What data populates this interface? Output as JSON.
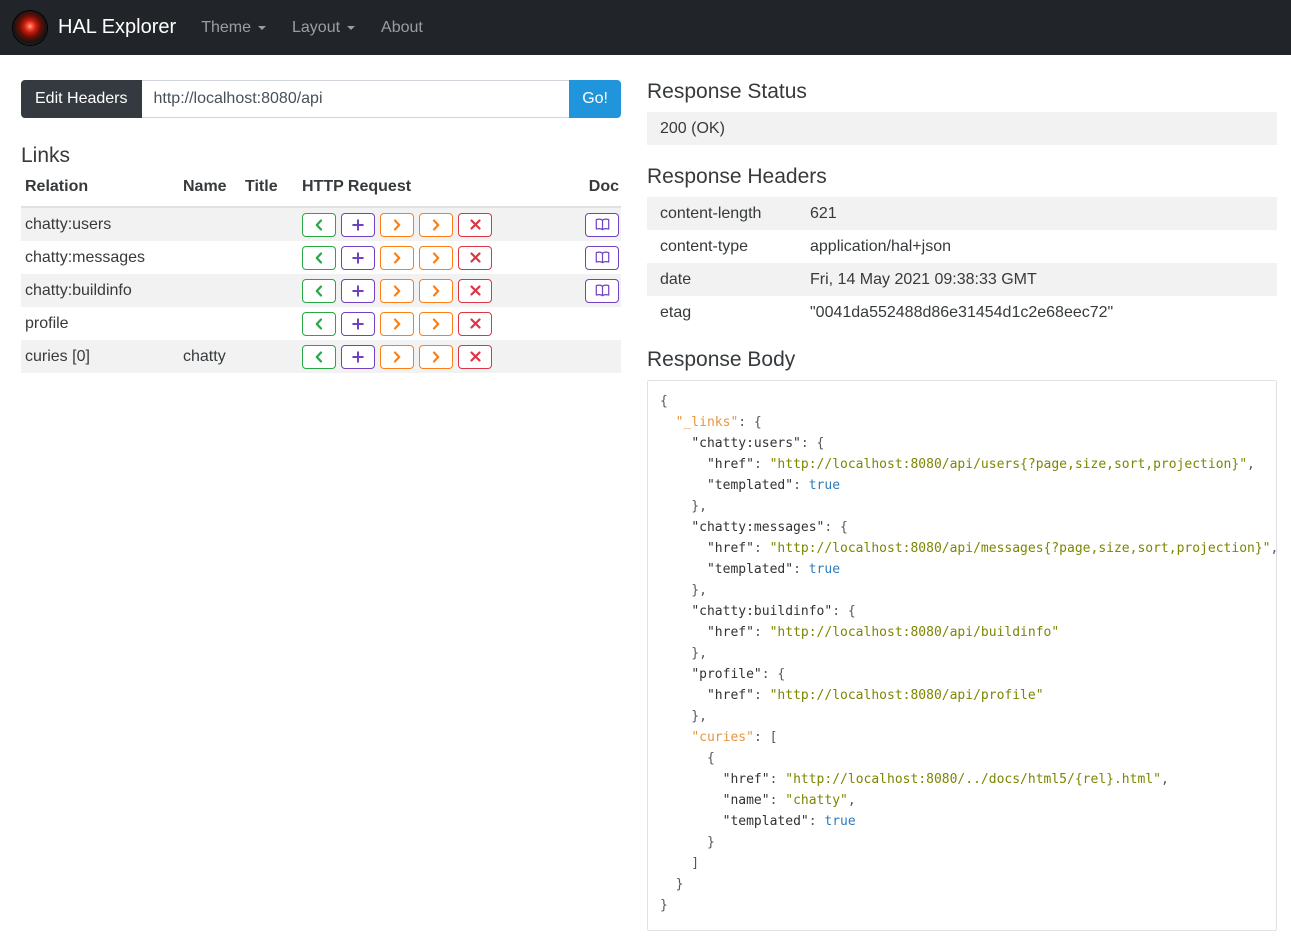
{
  "navbar": {
    "brand": "HAL Explorer",
    "logo_icon": "hal-eye-icon",
    "items": [
      {
        "label": "Theme",
        "has_caret": true
      },
      {
        "label": "Layout",
        "has_caret": true
      },
      {
        "label": "About",
        "has_caret": false
      }
    ]
  },
  "request_bar": {
    "edit_headers_label": "Edit Headers",
    "url_value": "http://localhost:8080/api",
    "go_label": "Go!"
  },
  "links_section": {
    "title": "Links",
    "columns": [
      "Relation",
      "Name",
      "Title",
      "HTTP Request",
      "Doc"
    ],
    "rows": [
      {
        "relation": "chatty:users",
        "name": "",
        "title": "",
        "doc": true
      },
      {
        "relation": "chatty:messages",
        "name": "",
        "title": "",
        "doc": true
      },
      {
        "relation": "chatty:buildinfo",
        "name": "",
        "title": "",
        "doc": true
      },
      {
        "relation": "profile",
        "name": "",
        "title": "",
        "doc": false
      },
      {
        "relation": "curies [0]",
        "name": "chatty",
        "title": "",
        "doc": false
      }
    ],
    "http_buttons": [
      {
        "name": "get-request-button",
        "icon": "chevron-left-icon",
        "color": "#28a745"
      },
      {
        "name": "post-request-button",
        "icon": "plus-icon",
        "color": "#6f42c1"
      },
      {
        "name": "put-request-button",
        "icon": "chevron-right-icon",
        "color": "#fd7e14"
      },
      {
        "name": "patch-request-button",
        "icon": "chevron-right-icon",
        "color": "#fd7e14"
      },
      {
        "name": "delete-request-button",
        "icon": "x-icon",
        "color": "#dc3545"
      }
    ],
    "doc_button": {
      "name": "doc-button",
      "icon": "book-icon",
      "color": "#6f42c1"
    }
  },
  "response": {
    "status_title": "Response Status",
    "status_value": "200 (OK)",
    "headers_title": "Response Headers",
    "headers": [
      {
        "name": "content-length",
        "value": "621"
      },
      {
        "name": "content-type",
        "value": "application/hal+json"
      },
      {
        "name": "date",
        "value": "Fri, 14 May 2021 09:38:33 GMT"
      },
      {
        "name": "etag",
        "value": "\"0041da552488d86e31454d1c2e68eec72\""
      }
    ],
    "body_title": "Response Body",
    "body_lines": [
      [
        [
          "pl",
          "{"
        ]
      ],
      [
        [
          "pl",
          "  "
        ],
        [
          "okey",
          "\"_links\""
        ],
        [
          "pl",
          ": {"
        ]
      ],
      [
        [
          "pl",
          "    "
        ],
        [
          "key",
          "\"chatty:users\""
        ],
        [
          "pl",
          ": {"
        ]
      ],
      [
        [
          "pl",
          "      "
        ],
        [
          "key",
          "\"href\""
        ],
        [
          "pl",
          ": "
        ],
        [
          "str",
          "\"http://localhost:8080/api/users{?page,size,sort,projection}\""
        ],
        [
          "pl",
          ","
        ]
      ],
      [
        [
          "pl",
          "      "
        ],
        [
          "key",
          "\"templated\""
        ],
        [
          "pl",
          ": "
        ],
        [
          "bool",
          "true"
        ]
      ],
      [
        [
          "pl",
          "    },"
        ]
      ],
      [
        [
          "pl",
          "    "
        ],
        [
          "key",
          "\"chatty:messages\""
        ],
        [
          "pl",
          ": {"
        ]
      ],
      [
        [
          "pl",
          "      "
        ],
        [
          "key",
          "\"href\""
        ],
        [
          "pl",
          ": "
        ],
        [
          "str",
          "\"http://localhost:8080/api/messages{?page,size,sort,projection}\""
        ],
        [
          "pl",
          ","
        ]
      ],
      [
        [
          "pl",
          "      "
        ],
        [
          "key",
          "\"templated\""
        ],
        [
          "pl",
          ": "
        ],
        [
          "bool",
          "true"
        ]
      ],
      [
        [
          "pl",
          "    },"
        ]
      ],
      [
        [
          "pl",
          "    "
        ],
        [
          "key",
          "\"chatty:buildinfo\""
        ],
        [
          "pl",
          ": {"
        ]
      ],
      [
        [
          "pl",
          "      "
        ],
        [
          "key",
          "\"href\""
        ],
        [
          "pl",
          ": "
        ],
        [
          "str",
          "\"http://localhost:8080/api/buildinfo\""
        ]
      ],
      [
        [
          "pl",
          "    },"
        ]
      ],
      [
        [
          "pl",
          "    "
        ],
        [
          "key",
          "\"profile\""
        ],
        [
          "pl",
          ": {"
        ]
      ],
      [
        [
          "pl",
          "      "
        ],
        [
          "key",
          "\"href\""
        ],
        [
          "pl",
          ": "
        ],
        [
          "str",
          "\"http://localhost:8080/api/profile\""
        ]
      ],
      [
        [
          "pl",
          "    },"
        ]
      ],
      [
        [
          "pl",
          "    "
        ],
        [
          "okey",
          "\"curies\""
        ],
        [
          "pl",
          ": ["
        ]
      ],
      [
        [
          "pl",
          "      {"
        ]
      ],
      [
        [
          "pl",
          "        "
        ],
        [
          "key",
          "\"href\""
        ],
        [
          "pl",
          ": "
        ],
        [
          "str",
          "\"http://localhost:8080/../docs/html5/{rel}.html\""
        ],
        [
          "pl",
          ","
        ]
      ],
      [
        [
          "pl",
          "        "
        ],
        [
          "key",
          "\"name\""
        ],
        [
          "pl",
          ": "
        ],
        [
          "str",
          "\"chatty\""
        ],
        [
          "pl",
          ","
        ]
      ],
      [
        [
          "pl",
          "        "
        ],
        [
          "key",
          "\"templated\""
        ],
        [
          "pl",
          ": "
        ],
        [
          "bool",
          "true"
        ]
      ],
      [
        [
          "pl",
          "      }"
        ]
      ],
      [
        [
          "pl",
          "    ]"
        ]
      ],
      [
        [
          "pl",
          "  }"
        ]
      ],
      [
        [
          "pl",
          "}"
        ]
      ]
    ]
  },
  "colors": {
    "navbar_bg": "#212529",
    "stripe": "#f2f2f2",
    "go_button": "#2095db",
    "edit_headers_button": "#343a40",
    "get": "#28a745",
    "post": "#6f42c1",
    "put_patch": "#fd7e14",
    "delete": "#dc3545",
    "doc": "#6f42c1"
  }
}
